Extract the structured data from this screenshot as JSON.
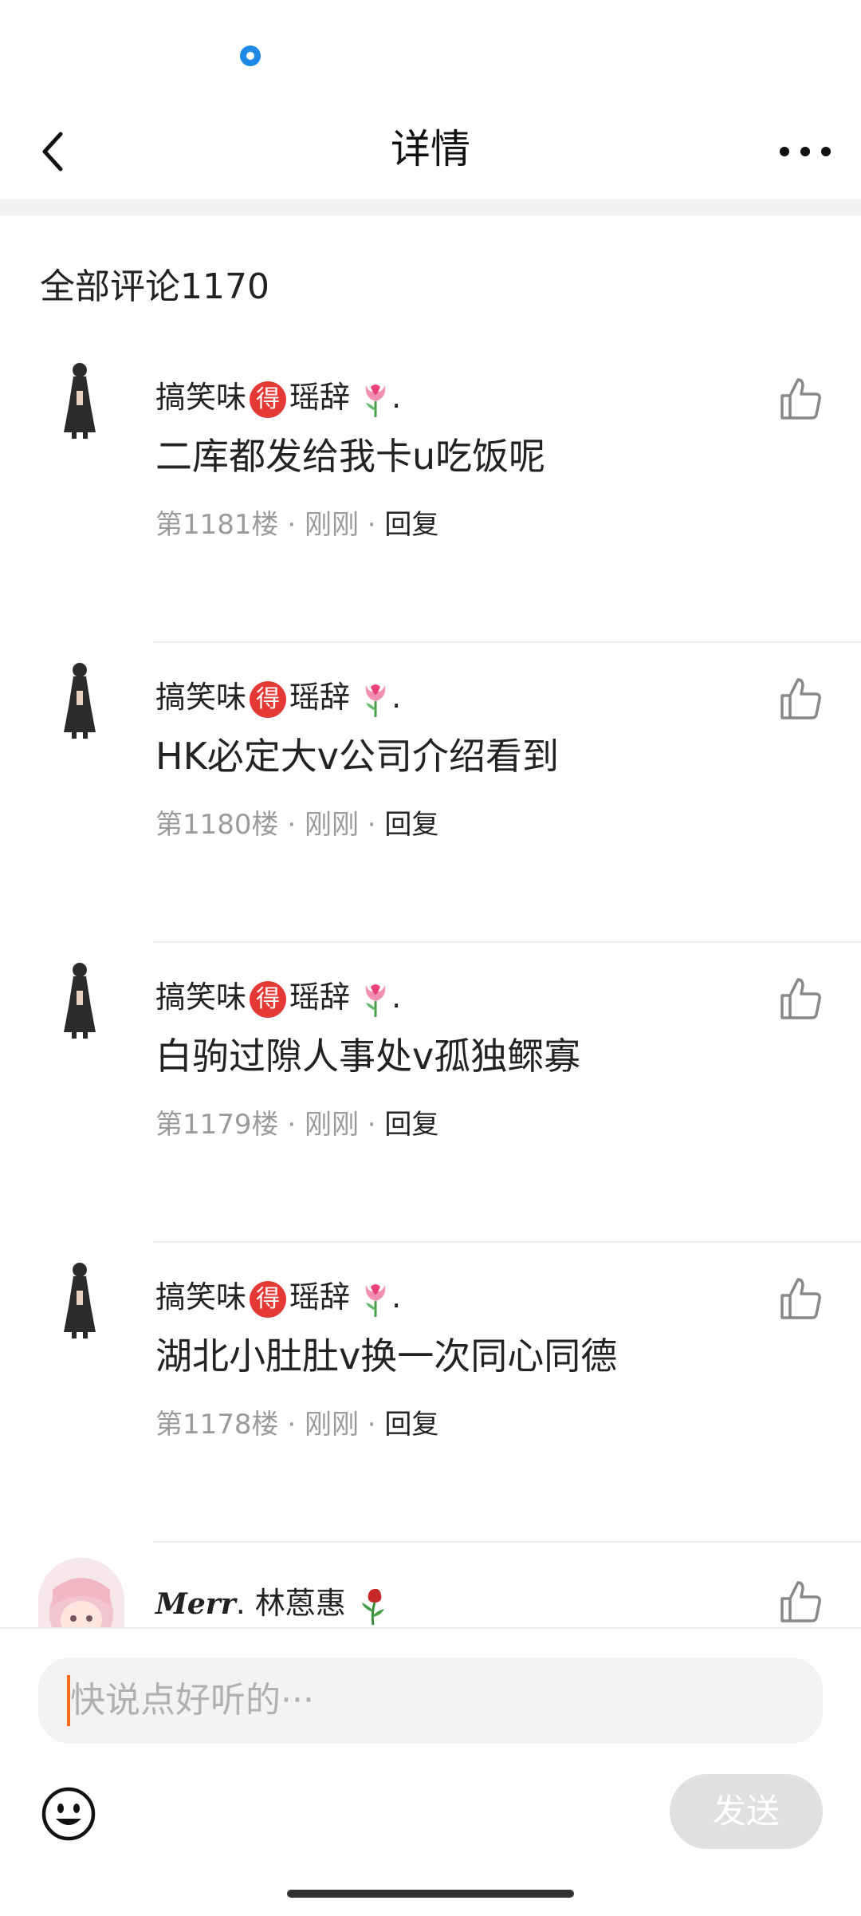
{
  "nav": {
    "title": "详情"
  },
  "section": {
    "title": "全部评论1170"
  },
  "comments": [
    {
      "user": "搞笑味",
      "badge": "得",
      "user_suffix": "瑶辞",
      "dot": ".",
      "content": "二库都发给我卡u吃饭呢",
      "floor": "第1181楼",
      "time": "刚刚",
      "reply": "回复"
    },
    {
      "user": "搞笑味",
      "badge": "得",
      "user_suffix": "瑶辞",
      "dot": ".",
      "content": "HK必定大v公司介绍看到",
      "floor": "第1180楼",
      "time": "刚刚",
      "reply": "回复"
    },
    {
      "user": "搞笑味",
      "badge": "得",
      "user_suffix": "瑶辞",
      "dot": ".",
      "content": "白驹过隙人事处v孤独鳏寡",
      "floor": "第1179楼",
      "time": "刚刚",
      "reply": "回复"
    },
    {
      "user": "搞笑味",
      "badge": "得",
      "user_suffix": "瑶辞",
      "dot": ".",
      "content": "湖北小肚肚v换一次同心同德",
      "floor": "第1178楼",
      "time": "刚刚",
      "reply": "回复"
    }
  ],
  "partial_comment": {
    "user_prefix": "Merr",
    "user": ". 林蒽惠"
  },
  "meta_sep": " · ",
  "input": {
    "placeholder": "快说点好听的···"
  },
  "send": {
    "label": "发送"
  },
  "icons": {
    "back": "chevron-left-icon",
    "more": "more-horizontal-icon",
    "like": "thumbs-up-icon",
    "emoji": "smiley-icon",
    "tulip": "tulip-icon",
    "rose": "wilted-rose-icon"
  },
  "colors": {
    "badge": "#e53935",
    "cursor": "#ff6d1a",
    "status_dot": "#1e88e5",
    "send_disabled": "#e0e0e0"
  }
}
